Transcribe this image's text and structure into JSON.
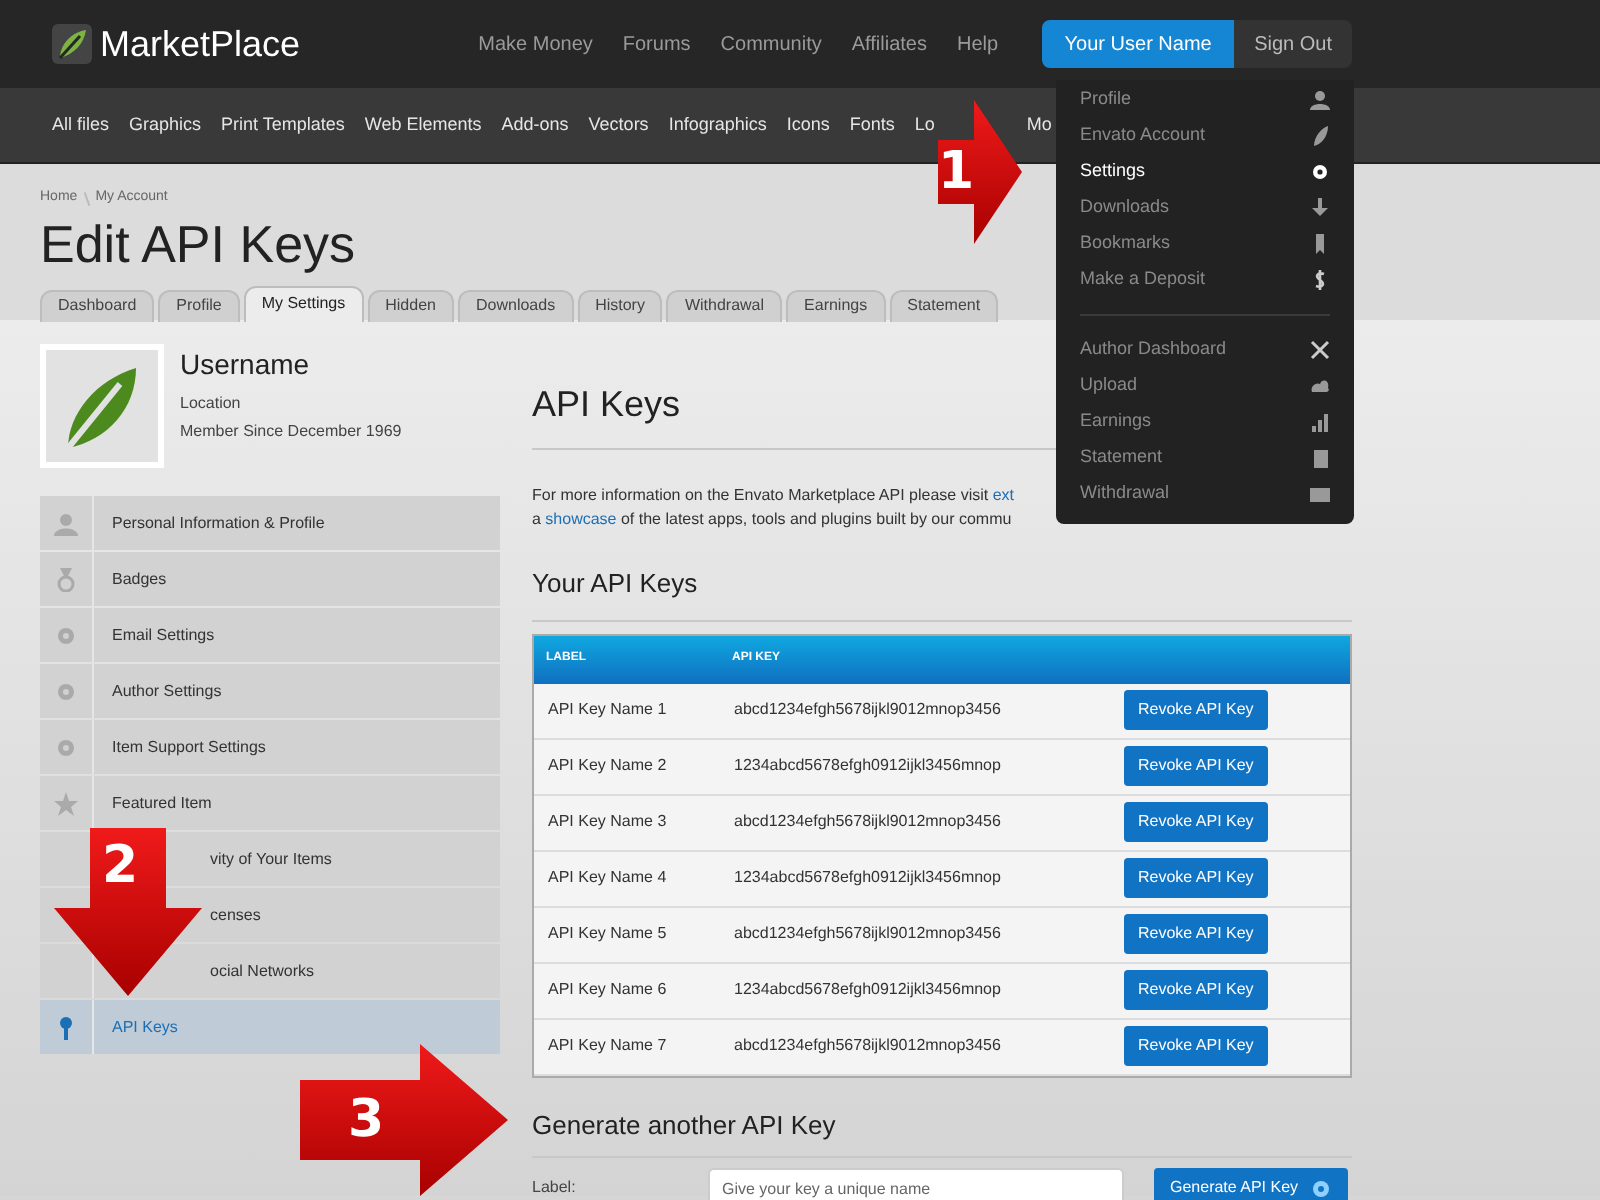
{
  "site": {
    "logo": "MarketPlace",
    "top_links": [
      "Make Money",
      "Forums",
      "Community",
      "Affiliates",
      "Help"
    ],
    "user_button": {
      "label": "Your User Name",
      "selected": true
    },
    "sign_out": "Sign Out"
  },
  "categories": [
    "All files",
    "Graphics",
    "Print Templates",
    "Web Elements",
    "Add-ons",
    "Vectors",
    "Infographics",
    "Icons",
    "Fonts",
    "Lo",
    "Mo"
  ],
  "user_menu": {
    "groups": [
      [
        {
          "label": "Profile",
          "selected": false
        },
        {
          "label": "Envato Account",
          "selected": false
        },
        {
          "label": "Settings",
          "selected": true
        },
        {
          "label": "Downloads",
          "selected": false
        },
        {
          "label": "Bookmarks",
          "selected": false
        },
        {
          "label": "Make a Deposit",
          "selected": false
        }
      ],
      [
        {
          "label": "Author Dashboard",
          "selected": false
        },
        {
          "label": "Upload",
          "selected": false
        },
        {
          "label": "Earnings",
          "selected": false
        },
        {
          "label": "Statement",
          "selected": false
        },
        {
          "label": "Withdrawal",
          "selected": false
        }
      ]
    ]
  },
  "breadcrumb": [
    "Home",
    "My Account"
  ],
  "page_title": "Edit API Keys",
  "tabs": [
    {
      "label": "Dashboard",
      "selected": false
    },
    {
      "label": "Profile",
      "selected": false
    },
    {
      "label": "My Settings",
      "selected": true
    },
    {
      "label": "Hidden",
      "selected": false
    },
    {
      "label": "Downloads",
      "selected": false
    },
    {
      "label": "History",
      "selected": false
    },
    {
      "label": "Withdrawal",
      "selected": false
    },
    {
      "label": "Earnings",
      "selected": false
    },
    {
      "label": "Statement",
      "selected": false
    }
  ],
  "profile": {
    "name": "Username",
    "location": "Location",
    "member_since": "Member Since December 1969"
  },
  "sidebar": {
    "items": [
      {
        "label": "Personal Information & Profile",
        "selected": false,
        "kind": "full"
      },
      {
        "label": "Badges",
        "selected": false,
        "kind": "full"
      },
      {
        "label": "Email Settings",
        "selected": false,
        "kind": "full"
      },
      {
        "label": "Author Settings",
        "selected": false,
        "kind": "full"
      },
      {
        "label": "Item Support Settings",
        "selected": false,
        "kind": "full"
      },
      {
        "label": "Featured Item",
        "selected": false,
        "kind": "full"
      },
      {
        "label": "vity of Your Items",
        "selected": false,
        "kind": "partial"
      },
      {
        "label": "censes",
        "selected": false,
        "kind": "partial"
      },
      {
        "label": "ocial Networks",
        "selected": false,
        "kind": "partial"
      },
      {
        "label": "API Keys",
        "selected": true,
        "kind": "full"
      }
    ]
  },
  "main": {
    "heading": "API Keys",
    "intro": [
      [
        {
          "text": "For more information on the Envato Marketplace API please visit ",
          "link": false
        },
        {
          "text": "ext",
          "link": true
        }
      ],
      [
        {
          "text": "a ",
          "link": false
        },
        {
          "text": "showcase",
          "link": true
        },
        {
          "text": " of the latest apps, tools and plugins built by our commu",
          "link": false
        }
      ]
    ],
    "keys_heading": "Your API Keys",
    "table": {
      "columns": [
        "LABEL",
        "API KEY"
      ],
      "rows": [
        {
          "label": "API Key Name 1",
          "key": "abcd1234efgh5678ijkl9012mnop3456",
          "action": "Revoke API Key"
        },
        {
          "label": "API Key Name 2",
          "key": "1234abcd5678efgh0912ijkl3456mnop",
          "action": "Revoke API Key"
        },
        {
          "label": "API Key Name 3",
          "key": "abcd1234efgh5678ijkl9012mnop3456",
          "action": "Revoke API Key"
        },
        {
          "label": "API Key Name 4",
          "key": "1234abcd5678efgh0912ijkl3456mnop",
          "action": "Revoke API Key"
        },
        {
          "label": "API Key Name 5",
          "key": "abcd1234efgh5678ijkl9012mnop3456",
          "action": "Revoke API Key"
        },
        {
          "label": "API Key Name 6",
          "key": "1234abcd5678efgh0912ijkl3456mnop",
          "action": "Revoke API Key"
        },
        {
          "label": "API Key Name 7",
          "key": "abcd1234efgh5678ijkl9012mnop3456",
          "action": "Revoke API Key"
        }
      ]
    },
    "generate": {
      "heading": "Generate another API Key",
      "label": "Label:",
      "placeholder": "Give your key a unique name",
      "button": "Generate API Key"
    }
  },
  "callouts": [
    "1",
    "2",
    "3"
  ]
}
